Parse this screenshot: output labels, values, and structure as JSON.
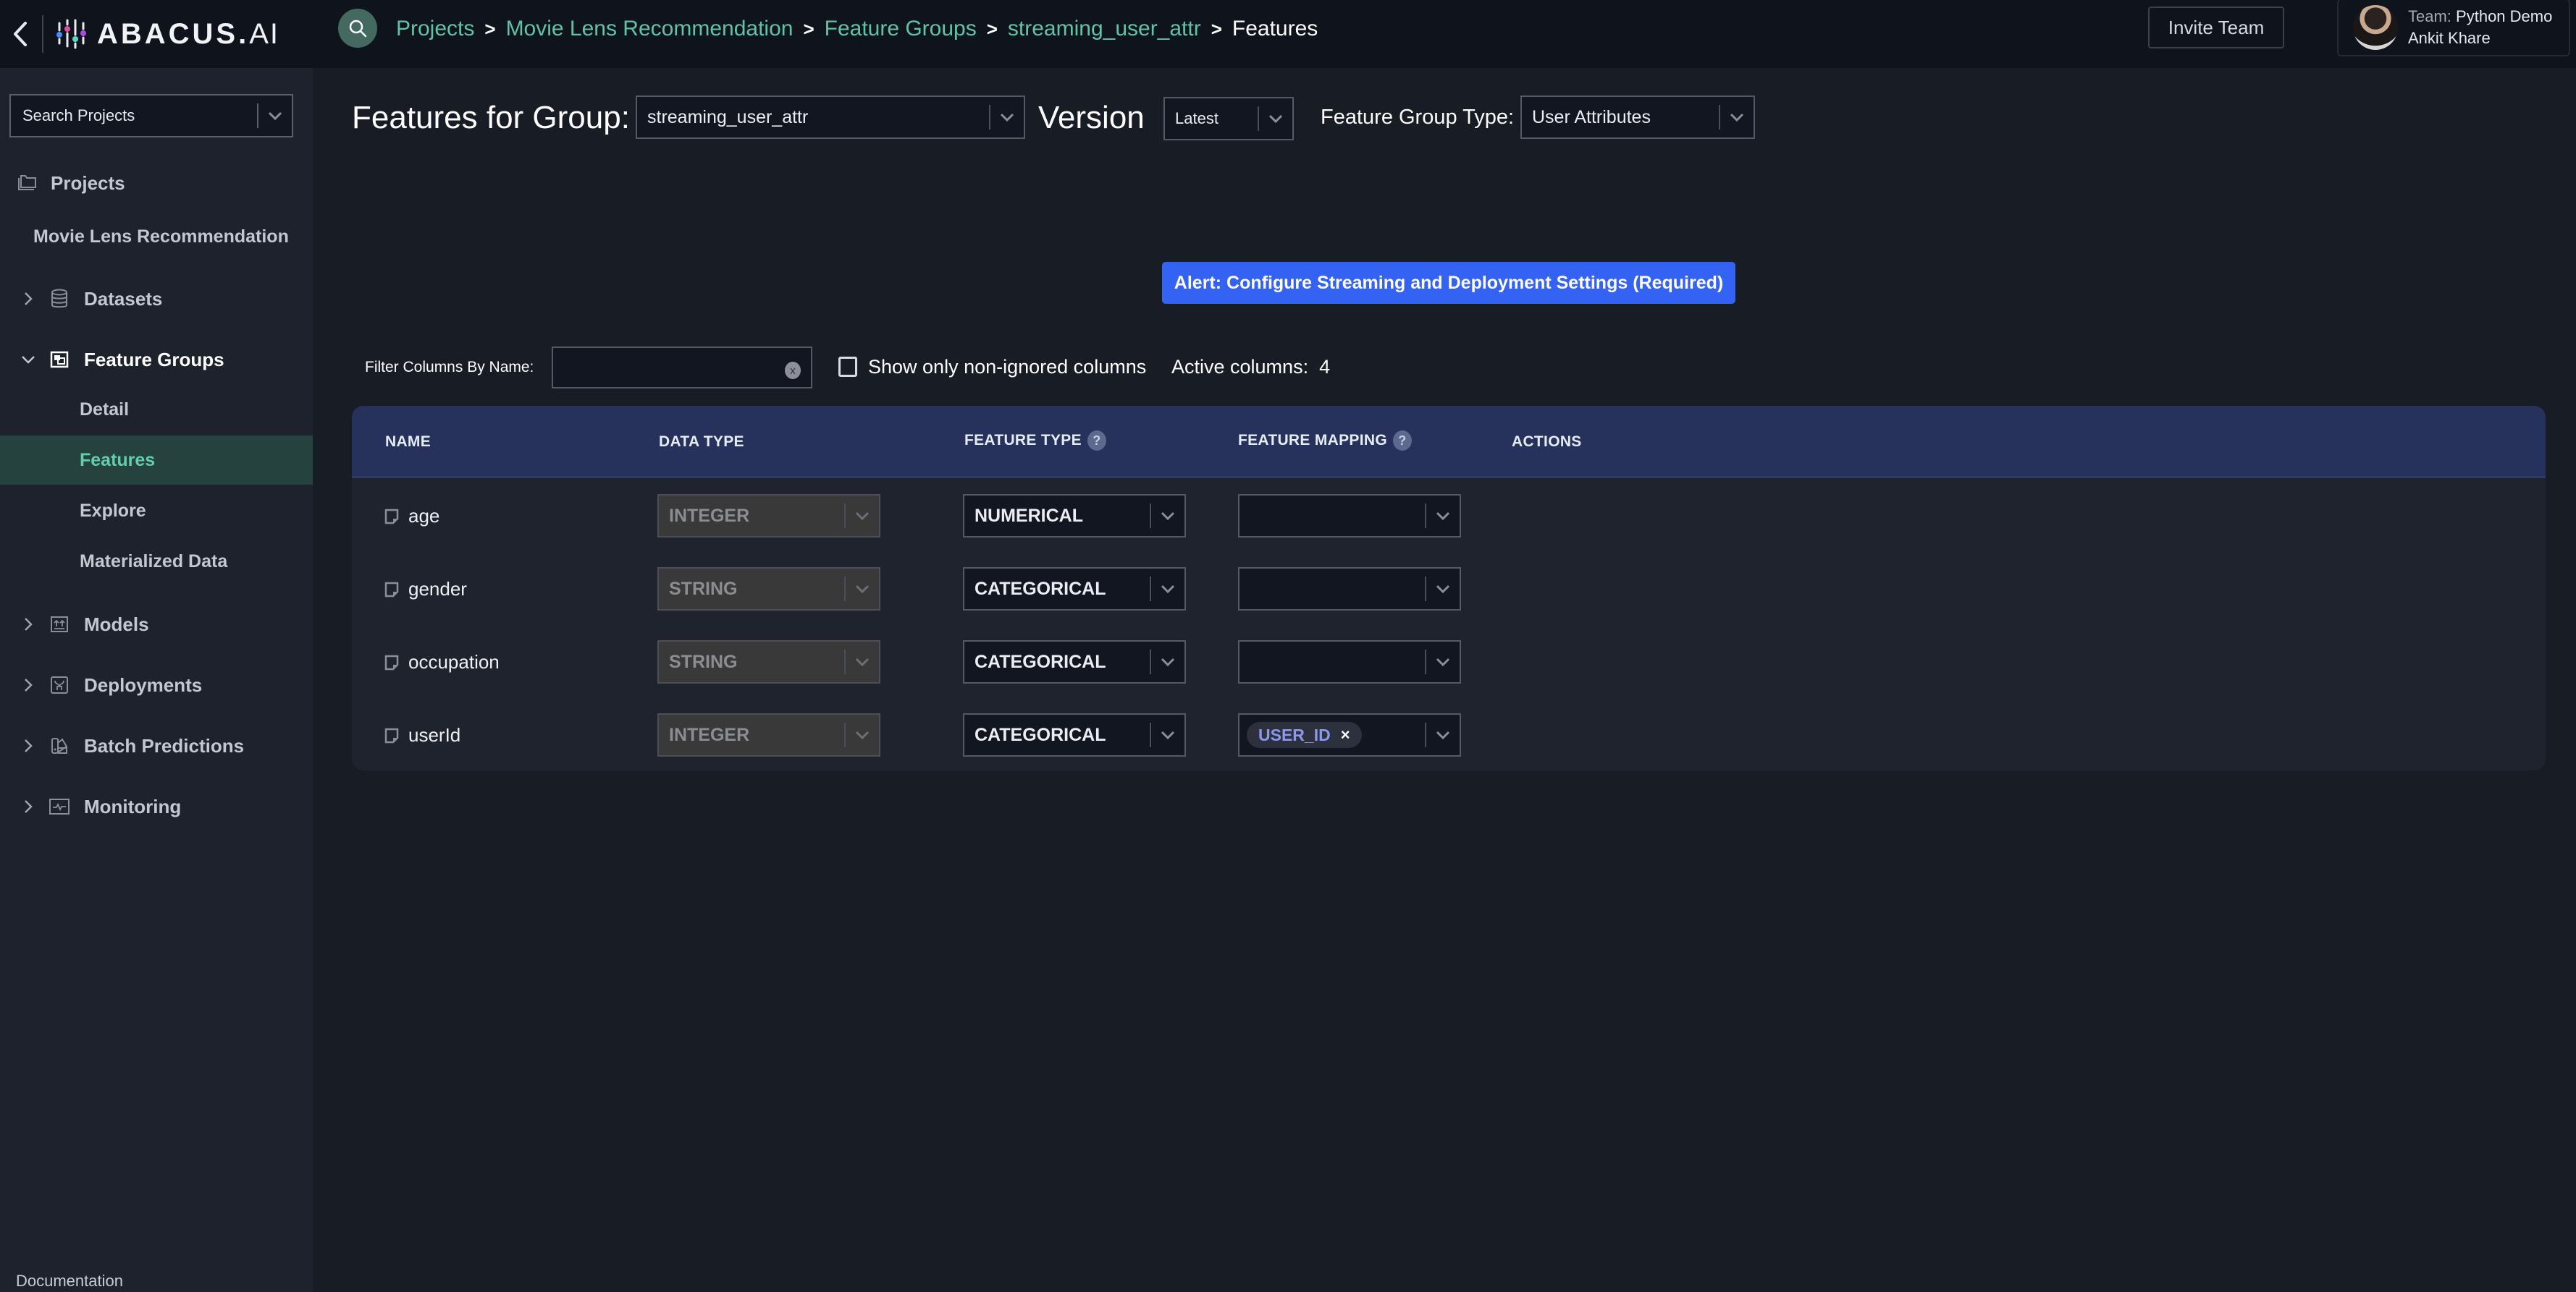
{
  "app": {
    "logo_text": "ABACUS.",
    "logo_suffix": "AI",
    "logo_colors": {
      "blue": "#4c8cf5",
      "pink": "#d94fa8",
      "teal": "#5fd6c9",
      "purple": "#a74ee0"
    }
  },
  "header": {
    "breadcrumb": [
      {
        "label": "Projects"
      },
      {
        "label": "Movie Lens Recommendation"
      },
      {
        "label": "Feature Groups"
      },
      {
        "label": "streaming_user_attr"
      },
      {
        "label": "Features"
      }
    ],
    "breadcrumb_separator": ">",
    "invite_label": "Invite Team",
    "user": {
      "team_label": "Team:",
      "team_name": "Python Demo",
      "name": "Ankit Khare"
    }
  },
  "sidebar": {
    "search_placeholder": "Search Projects",
    "projects_label": "Projects",
    "project_name": "Movie Lens Recommendation",
    "items": [
      {
        "label": "Datasets",
        "expanded": false
      },
      {
        "label": "Feature Groups",
        "expanded": true,
        "children": [
          {
            "label": "Detail",
            "active": false
          },
          {
            "label": "Features",
            "active": true
          },
          {
            "label": "Explore",
            "active": false
          },
          {
            "label": "Materialized Data",
            "active": false
          }
        ]
      },
      {
        "label": "Models",
        "expanded": false
      },
      {
        "label": "Deployments",
        "expanded": false
      },
      {
        "label": "Batch Predictions",
        "expanded": false
      },
      {
        "label": "Monitoring",
        "expanded": false
      }
    ],
    "documentation_label": "Documentation"
  },
  "main": {
    "title": "Features for Group:",
    "group_value": "streaming_user_attr",
    "version_label": "Version",
    "version_value": "Latest",
    "group_type_label": "Feature Group Type:",
    "group_type_value": "User Attributes",
    "alert_label": "Alert: Configure Streaming and Deployment Settings (Required)",
    "filter_label": "Filter Columns By Name:",
    "filter_value": "",
    "clear_label": "x",
    "show_nonignored_label": "Show only non-ignored columns",
    "show_nonignored_checked": false,
    "active_columns_label": "Active columns:",
    "active_columns_count": "4"
  },
  "table": {
    "columns": [
      "NAME",
      "DATA TYPE",
      "FEATURE TYPE",
      "FEATURE MAPPING",
      "ACTIONS"
    ],
    "help_glyph": "?",
    "rows": [
      {
        "name": "age",
        "data_type": "INTEGER",
        "feature_type": "NUMERICAL",
        "feature_mapping": ""
      },
      {
        "name": "gender",
        "data_type": "STRING",
        "feature_type": "CATEGORICAL",
        "feature_mapping": ""
      },
      {
        "name": "occupation",
        "data_type": "STRING",
        "feature_type": "CATEGORICAL",
        "feature_mapping": ""
      },
      {
        "name": "userId",
        "data_type": "INTEGER",
        "feature_type": "CATEGORICAL",
        "feature_mapping": "USER_ID"
      }
    ],
    "tag_remove_glyph": "×"
  },
  "colors": {
    "accent_green": "#5fc4a6",
    "active_nav_bg": "#25423f",
    "alert_blue": "#3462f3",
    "table_header_bg": "#26325c",
    "tag_text": "#8a98ee"
  }
}
